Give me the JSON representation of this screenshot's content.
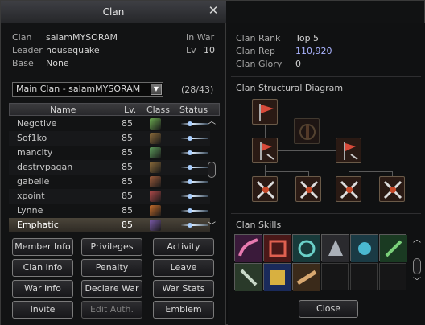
{
  "window": {
    "title": "Clan"
  },
  "clan": {
    "clan_label": "Clan",
    "clan_name": "salamMYSORAM",
    "war_status": "In War",
    "leader_label": "Leader",
    "leader_name": "housequake",
    "lv_label": "Lv",
    "lv_value": "10",
    "base_label": "Base",
    "base_value": "None"
  },
  "roster": {
    "select_value": "Main Clan - salamMYSORAM",
    "count": "(28/43)",
    "headers": {
      "name": "Name",
      "lv": "Lv.",
      "class": "Class",
      "status": "Status"
    },
    "members": [
      {
        "name": "Negotive",
        "lv": "85",
        "class_color": "#6aa84f"
      },
      {
        "name": "Sof1ko",
        "lv": "85",
        "class_color": "#8a6a3a"
      },
      {
        "name": "mancity",
        "lv": "85",
        "class_color": "#5c9a5a"
      },
      {
        "name": "destrvpagan",
        "lv": "85",
        "class_color": "#8a6a3a"
      },
      {
        "name": "gabelle",
        "lv": "85",
        "class_color": "#9a5a3a"
      },
      {
        "name": "xpoint",
        "lv": "85",
        "class_color": "#b04a4a"
      },
      {
        "name": "Lynne",
        "lv": "85",
        "class_color": "#c26a2a"
      },
      {
        "name": "Emphatic",
        "lv": "85",
        "class_color": "#7a5aa8"
      }
    ]
  },
  "buttons": [
    {
      "label": "Member Info",
      "disabled": false
    },
    {
      "label": "Privileges",
      "disabled": false
    },
    {
      "label": "Activity",
      "disabled": false
    },
    {
      "label": "Clan Info",
      "disabled": false
    },
    {
      "label": "Penalty",
      "disabled": false
    },
    {
      "label": "Leave",
      "disabled": false
    },
    {
      "label": "War Info",
      "disabled": false
    },
    {
      "label": "Declare War",
      "disabled": false
    },
    {
      "label": "War Stats",
      "disabled": false
    },
    {
      "label": "Invite",
      "disabled": false
    },
    {
      "label": "Edit Auth.",
      "disabled": true
    },
    {
      "label": "Emblem",
      "disabled": false
    }
  ],
  "stats": {
    "rank_label": "Clan Rank",
    "rank_value": "Top 5",
    "rep_label": "Clan Rep",
    "rep_value": "110,920",
    "glory_label": "Clan Glory",
    "glory_value": "0"
  },
  "diagram": {
    "title": "Clan Structural Diagram"
  },
  "skills": {
    "title": "Clan Skills"
  },
  "footer": {
    "close_label": "Close"
  },
  "colors": {
    "accent": "#aab4ff",
    "selected_row": "#4b453a"
  }
}
